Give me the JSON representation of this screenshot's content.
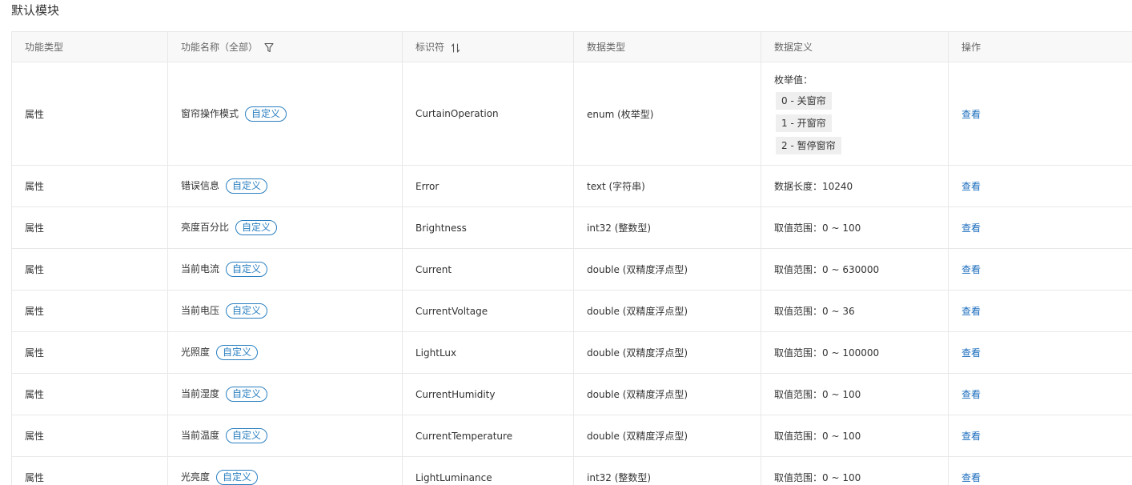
{
  "module_title": "默认模块",
  "headers": {
    "type": "功能类型",
    "name": "功能名称（全部）",
    "identifier": "标识符",
    "data_type": "数据类型",
    "definition": "数据定义",
    "action": "操作"
  },
  "icons": {
    "filter": "filter-icon",
    "sort": "sort-icon"
  },
  "colors": {
    "tag": "#2a7fc0",
    "link": "#1b6dbd",
    "header_bg": "#f8f8f8"
  },
  "enum_label": "枚举值：",
  "rows": [
    {
      "type": "属性",
      "name": "窗帘操作模式",
      "tag": "自定义",
      "identifier": "CurtainOperation",
      "data_type": "enum (枚举型)",
      "definition": "",
      "enum_items": [
        "0 - 关窗帘",
        "1 - 开窗帘",
        "2 - 暂停窗帘"
      ],
      "action": "查看"
    },
    {
      "type": "属性",
      "name": "错误信息",
      "tag": "自定义",
      "identifier": "Error",
      "data_type": "text (字符串)",
      "definition": "数据长度：10240",
      "action": "查看"
    },
    {
      "type": "属性",
      "name": "亮度百分比",
      "tag": "自定义",
      "identifier": "Brightness",
      "data_type": "int32 (整数型)",
      "definition": "取值范围：0 ~ 100",
      "action": "查看"
    },
    {
      "type": "属性",
      "name": "当前电流",
      "tag": "自定义",
      "identifier": "Current",
      "data_type": "double (双精度浮点型)",
      "definition": "取值范围：0 ~ 630000",
      "action": "查看"
    },
    {
      "type": "属性",
      "name": "当前电压",
      "tag": "自定义",
      "identifier": "CurrentVoltage",
      "data_type": "double (双精度浮点型)",
      "definition": "取值范围：0 ~ 36",
      "action": "查看"
    },
    {
      "type": "属性",
      "name": "光照度",
      "tag": "自定义",
      "identifier": "LightLux",
      "data_type": "double (双精度浮点型)",
      "definition": "取值范围：0 ~ 100000",
      "action": "查看"
    },
    {
      "type": "属性",
      "name": "当前湿度",
      "tag": "自定义",
      "identifier": "CurrentHumidity",
      "data_type": "double (双精度浮点型)",
      "definition": "取值范围：0 ~ 100",
      "action": "查看"
    },
    {
      "type": "属性",
      "name": "当前温度",
      "tag": "自定义",
      "identifier": "CurrentTemperature",
      "data_type": "double (双精度浮点型)",
      "definition": "取值范围：0 ~ 100",
      "action": "查看"
    },
    {
      "type": "属性",
      "name": "光亮度",
      "tag": "自定义",
      "identifier": "LightLuminance",
      "data_type": "int32 (整数型)",
      "definition": "取值范围：0 ~ 100",
      "action": "查看"
    }
  ]
}
